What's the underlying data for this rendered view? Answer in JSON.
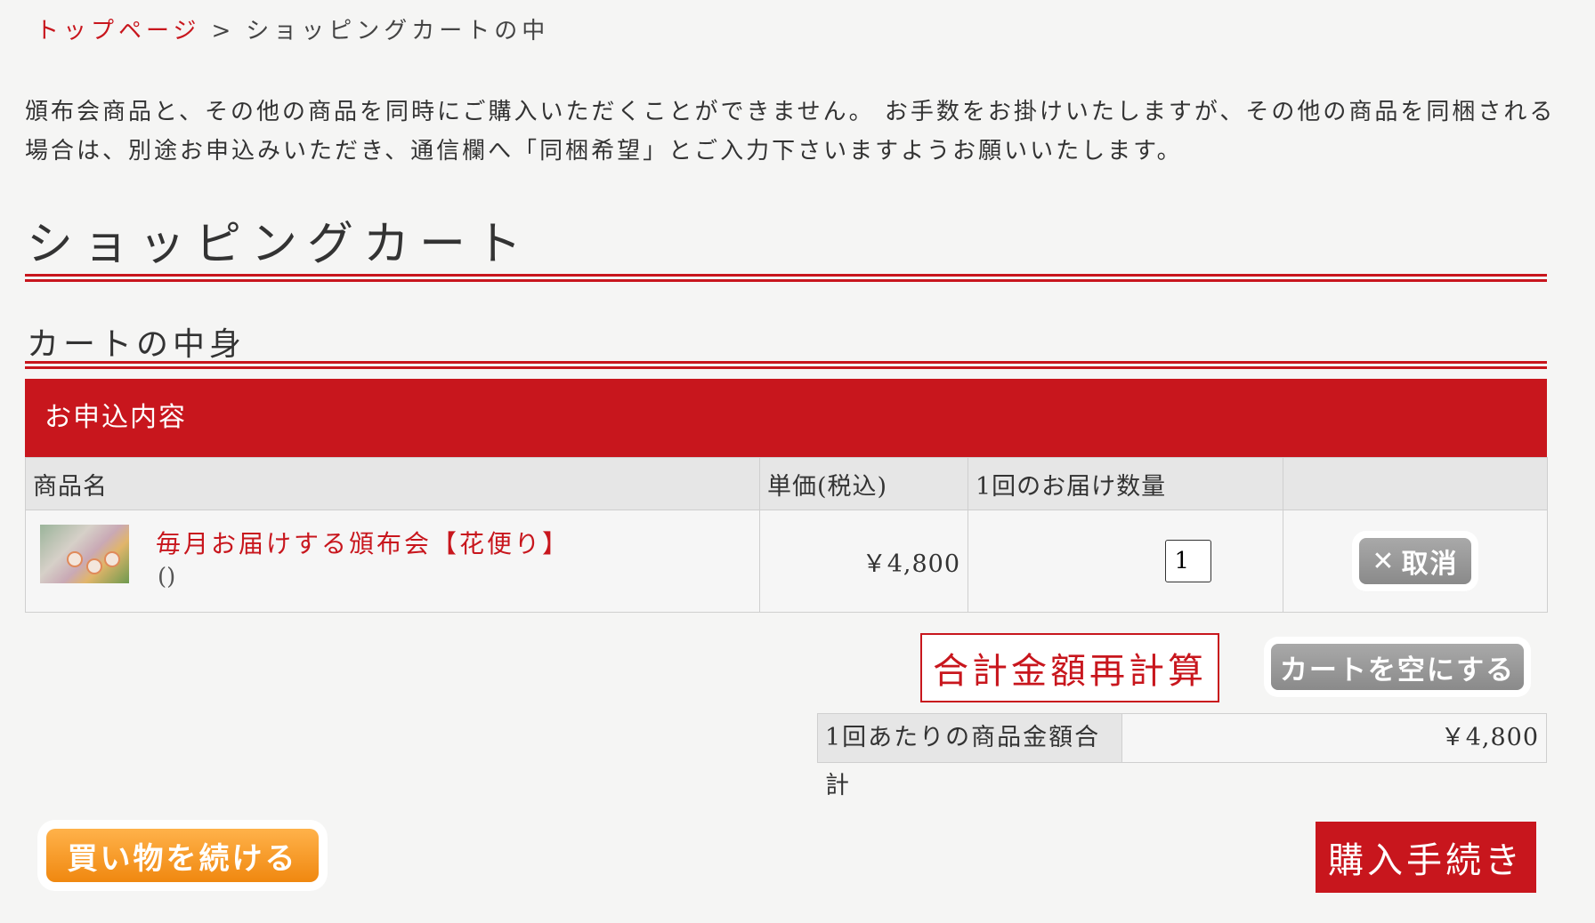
{
  "breadcrumb": {
    "home": "トップページ",
    "separator": ">",
    "current": "ショッピングカートの中"
  },
  "notice": "頒布会商品と、その他の商品を同時にご購入いただくことができません。 お手数をお掛けいたしますが、その他の商品を同梱される場合は、別途お申込みいただき、通信欄へ「同梱希望」とご入力下さいますようお願いいたします。",
  "page_title": "ショッピングカート",
  "section_title": "カートの中身",
  "order_header": "お申込内容",
  "table": {
    "columns": [
      "商品名",
      "単価(税込)",
      "1回のお届け数量",
      ""
    ],
    "rows": [
      {
        "image": "flower-sweets-thumbnail",
        "name": "毎月お届けする頒布会【花便り】",
        "variant": "()",
        "price": "￥4,800",
        "quantity": "1",
        "cancel_label": "取消",
        "cancel_icon": "x-icon"
      }
    ]
  },
  "recalc_label": "合計金額再計算",
  "empty_cart_label": "カートを空にする",
  "total": {
    "label": "1回あたりの商品金額合計",
    "value": "￥4,800"
  },
  "continue_label": "買い物を続ける",
  "purchase_label": "購入手続き",
  "colors": {
    "accent": "#c8161d",
    "orange_button": "#f39a1e",
    "gray_button": "#999999",
    "background": "#f5f5f4"
  }
}
